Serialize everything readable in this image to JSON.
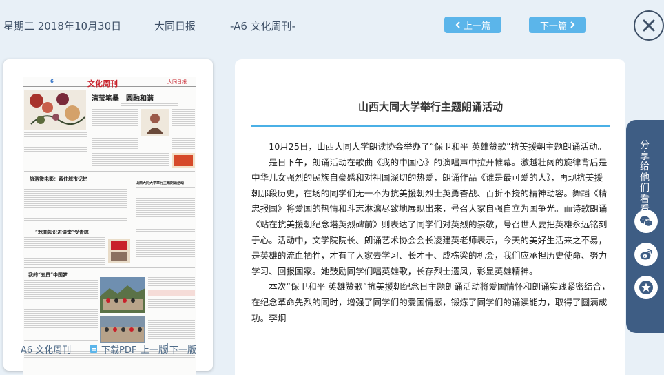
{
  "header": {
    "date": "星期二 2018年10月30日",
    "paper_name": "大同日报",
    "edition": "-A6 文化周刊-",
    "prev_article": "上一篇",
    "next_article": "下一篇",
    "close_icon": "close-circle-icon"
  },
  "thumbnail": {
    "page_number": "6",
    "masthead_title": "文化周刊",
    "masthead_logo": "大同日报",
    "headlines": [
      "清莹笔墨　圆融和谐",
      "旅游微电影：留住城市记忆",
      "“戏曲知识进课堂”受青睐",
      "我的“五员”中国梦",
      "山西大同大学举行主题朗诵活动"
    ],
    "edition_label": "A6 文化周刊",
    "download_pdf": "下载PDF",
    "page_prev": "上一版",
    "page_separator": "|",
    "page_next": "下一版"
  },
  "article": {
    "title": "山西大同大学举行主题朗诵活动",
    "paragraphs": [
      "10月25日，山西大同大学朗读协会举办了“保卫和平 英雄赞歌”抗美援朝主题朗诵活动。",
      "是日下午，朗诵活动在歌曲《我的中国心》的演唱声中拉开帷幕。激越壮阔的旋律背后是中华儿女强烈的民族自豪感和对祖国深切的热爱，朗诵作品《谁是最可爱的人》，再现抗美援朝那段历史，在场的同学们无一不为抗美援朝烈士英勇奋战、百折不挠的精神动容。舞蹈《精忠报国》将爱国的热情和斗志淋漓尽致地展现出来，号召大家自强自立为国争光。而诗歌朗诵《站在抗美援朝纪念塔英烈碑前》则表达了同学们对英烈的崇敬，号召世人要把英雄永远铭刻于心。活动中，文学院院长、朗诵艺术协会会长凌建英老师表示，今天的美好生活来之不易，是英雄的流血牺牲，才有了大家去学习、长才干、成栋梁的机会，我们应承担历史使命、努力学习、回报国家。她鼓励同学们唱英雄歌，长存烈士遗风，彰显英雄精神。",
      "本次“保卫和平 英雄赞歌”抗美援朝纪念日主题朗诵活动将爱国情怀和朗诵实践紧密结合，在纪念革命先烈的同时，增强了同学们的爱国情感，锻炼了同学们的诵读能力，取得了圆满成功。李炯"
    ]
  },
  "share": {
    "label": "分享给他们看看",
    "icons": [
      "wechat-icon",
      "weibo-icon",
      "favorite-star-icon"
    ]
  },
  "colors": {
    "background": "#e8f0f7",
    "accent_blue": "#5bb5ea",
    "share_tab": "#3e5d84",
    "header_text": "#3d4f66"
  }
}
